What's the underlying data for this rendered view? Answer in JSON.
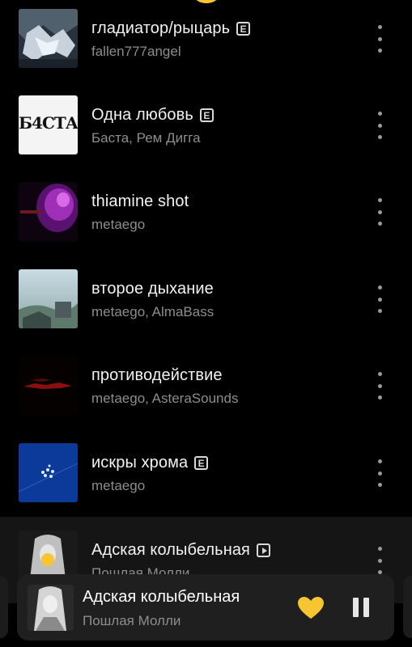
{
  "tracks": [
    {
      "title": "гладиатор/рыцарь",
      "artist": "fallen777angel",
      "badge": "E"
    },
    {
      "title": "Одна любовь",
      "artist": "Баста, Рем Дигга",
      "badge": "E",
      "cover_text": "Б4СТА"
    },
    {
      "title": "thiamine shot",
      "artist": "metaego",
      "badge": ""
    },
    {
      "title": "второе дыхание",
      "artist": "metaego, AlmaBass",
      "badge": ""
    },
    {
      "title": "противодействие",
      "artist": "metaego, AsteraSounds",
      "badge": ""
    },
    {
      "title": "искры хрома",
      "artist": "metaego",
      "badge": "E"
    },
    {
      "title": "Адская колыбельная",
      "artist": "Пошлая Молли",
      "badge": "video",
      "current": true
    }
  ],
  "player": {
    "title": "Адская колыбельная",
    "artist": "Пошлая Молли",
    "liked": true,
    "state": "playing"
  },
  "icons": {
    "more": "more-vertical-icon",
    "like": "heart-icon",
    "pause": "pause-icon",
    "explicit": "explicit-icon",
    "video": "video-clip-icon"
  },
  "colors": {
    "background": "#000000",
    "accent": "#f7c531",
    "title_text": "#f2f2f2",
    "secondary_text": "#8d8d8d",
    "player_bg": "#1f1f1f"
  }
}
